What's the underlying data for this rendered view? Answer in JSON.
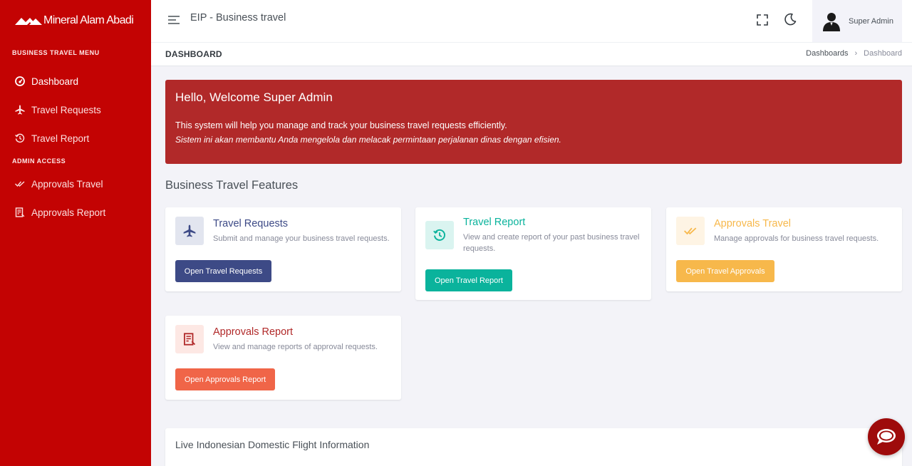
{
  "brand": {
    "name": "Mineral Alam Abadi"
  },
  "sidebar": {
    "menu_title": "BUSINESS TRAVEL MENU",
    "items": [
      {
        "label": "Dashboard",
        "icon": "dashboard-gauge-icon"
      },
      {
        "label": "Travel Requests",
        "icon": "airplane-icon"
      },
      {
        "label": "Travel Report",
        "icon": "history-icon"
      }
    ],
    "admin_title": "ADMIN ACCESS",
    "admin_items": [
      {
        "label": "Approvals Travel",
        "icon": "double-check-icon"
      },
      {
        "label": "Approvals Report",
        "icon": "report-document-icon"
      }
    ]
  },
  "topbar": {
    "app_title": "EIP - Business travel",
    "user_name": "Super Admin"
  },
  "titlebar": {
    "page_title": "DASHBOARD",
    "breadcrumb": [
      "Dashboards",
      "Dashboard"
    ]
  },
  "banner": {
    "title": "Hello, Welcome Super Admin",
    "text": "This system will help you manage and track your business travel requests efficiently.",
    "text_id": "Sistem ini akan membantu Anda mengelola dan melacak permintaan perjalanan dinas dengan efisien."
  },
  "features": {
    "section_title": "Business Travel Features",
    "cards": [
      {
        "title": "Travel Requests",
        "desc": "Submit and manage your business travel requests.",
        "button": "Open Travel Requests",
        "color": "#3d4a86",
        "icon_bg": "#e2e5ef"
      },
      {
        "title": "Travel Report",
        "desc": "View and create report of your past business travel requests.",
        "button": "Open Travel Report",
        "color": "#0ab39c",
        "icon_bg": "#daf4f0"
      },
      {
        "title": "Approvals Travel",
        "desc": "Manage approvals for business travel requests.",
        "button": "Open Travel Approvals",
        "color": "#f7b84b",
        "icon_bg": "#fef4e4"
      },
      {
        "title": "Approvals Report",
        "desc": "View and manage reports of approval requests.",
        "button": "Open Approvals Report",
        "color": "#f06548",
        "icon_bg": "#fde8e4",
        "title_color": "#b12929"
      }
    ]
  },
  "flight": {
    "title": "Live Indonesian Domestic Flight Information"
  },
  "colors": {
    "sidebar": "#c30303",
    "banner": "#b12929",
    "chat": "#9e0b0b"
  }
}
